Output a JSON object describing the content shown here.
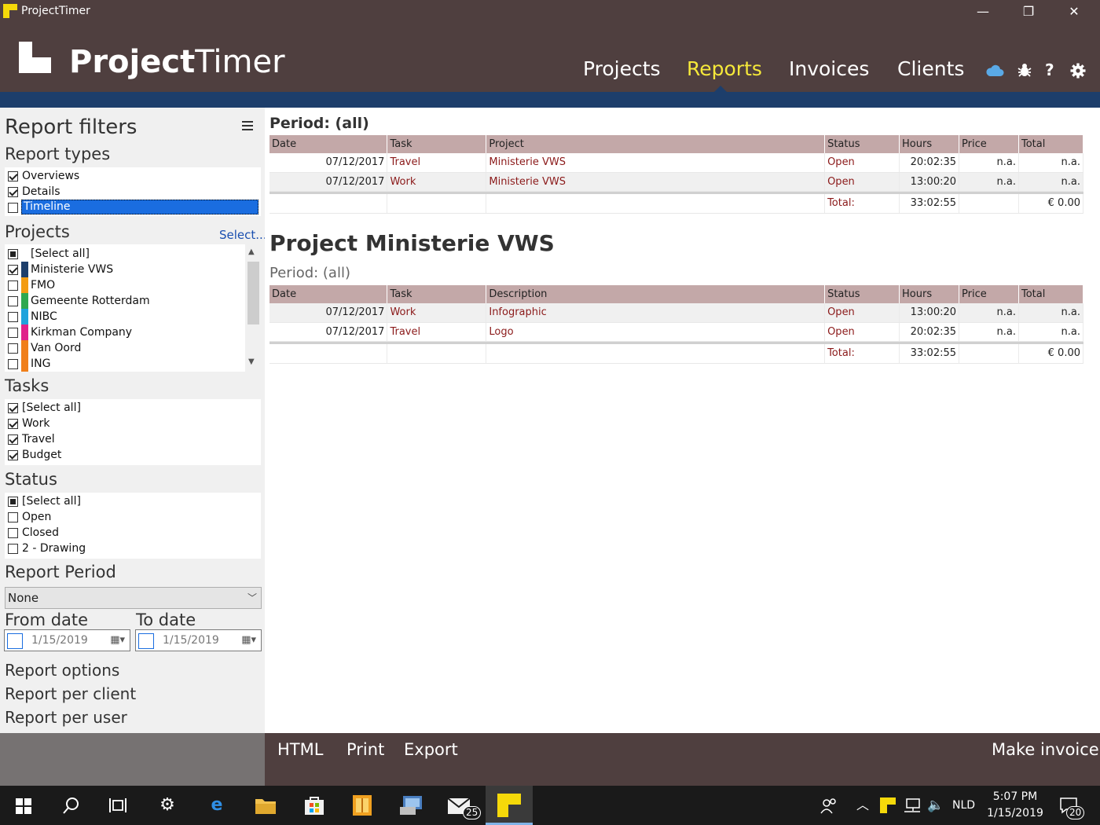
{
  "window": {
    "title": "ProjectTimer",
    "minimize": "—",
    "restore": "❐",
    "close": "✕"
  },
  "header": {
    "logo_bold": "Project",
    "logo_light": "Timer",
    "nav": [
      "Projects",
      "Reports",
      "Invoices",
      "Clients"
    ],
    "active_nav": "Reports",
    "icons": [
      "cloud-icon",
      "bug-icon",
      "help-icon",
      "gear-icon"
    ]
  },
  "filters": {
    "title": "Report filters",
    "report_types": {
      "title": "Report types",
      "items": [
        {
          "label": "Overviews",
          "checked": true
        },
        {
          "label": "Details",
          "checked": true
        },
        {
          "label": "Timeline",
          "checked": false,
          "selected": true
        }
      ]
    },
    "projects": {
      "title": "Projects",
      "select_link": "Select...",
      "items": [
        {
          "label": "[Select all]",
          "state": "partial",
          "color": ""
        },
        {
          "label": "Ministerie VWS",
          "state": "checked",
          "color": "#1d3e6b"
        },
        {
          "label": "FMO",
          "state": "unchecked",
          "color": "#f39c12"
        },
        {
          "label": "Gemeente Rotterdam",
          "state": "unchecked",
          "color": "#2fa84f"
        },
        {
          "label": "NIBC",
          "state": "unchecked",
          "color": "#1fa3dc"
        },
        {
          "label": "Kirkman Company",
          "state": "unchecked",
          "color": "#e0218a"
        },
        {
          "label": "Van Oord",
          "state": "unchecked",
          "color": "#f07f1a"
        },
        {
          "label": "ING",
          "state": "unchecked",
          "color": "#f07f1a"
        }
      ]
    },
    "tasks": {
      "title": "Tasks",
      "items": [
        {
          "label": "[Select all]",
          "state": "checked"
        },
        {
          "label": "Work",
          "state": "checked"
        },
        {
          "label": "Travel",
          "state": "checked"
        },
        {
          "label": "Budget",
          "state": "checked"
        }
      ]
    },
    "status": {
      "title": "Status",
      "items": [
        {
          "label": "[Select all]",
          "state": "partial"
        },
        {
          "label": "Open",
          "state": "unchecked"
        },
        {
          "label": "Closed",
          "state": "unchecked"
        },
        {
          "label": "2 - Drawing",
          "state": "unchecked"
        }
      ]
    },
    "period": {
      "title": "Report Period",
      "value": "None",
      "from_label": "From date",
      "to_label": "To date",
      "from_value": "1/15/2019",
      "to_value": "1/15/2019"
    },
    "options": [
      "Report options",
      "Report per client",
      "Report per user"
    ]
  },
  "report": {
    "overview": {
      "period_title": "Period: (all)",
      "columns": [
        "Date",
        "Task",
        "Project",
        "Status",
        "Hours",
        "Price",
        "Total"
      ],
      "rows": [
        [
          "07/12/2017",
          "Travel",
          "Ministerie VWS",
          "Open",
          "20:02:35",
          "n.a.",
          "n.a."
        ],
        [
          "07/12/2017",
          "Work",
          "Ministerie VWS",
          "Open",
          "13:00:20",
          "n.a.",
          "n.a."
        ]
      ],
      "total_label": "Total:",
      "total_hours": "33:02:55",
      "total_amount": "€ 0.00"
    },
    "project": {
      "title": "Project Ministerie VWS",
      "period": "Period: (all)",
      "columns": [
        "Date",
        "Task",
        "Description",
        "Status",
        "Hours",
        "Price",
        "Total"
      ],
      "rows": [
        [
          "07/12/2017",
          "Work",
          "Infographic",
          "Open",
          "13:00:20",
          "n.a.",
          "n.a."
        ],
        [
          "07/12/2017",
          "Travel",
          "Logo",
          "Open",
          "20:02:35",
          "n.a.",
          "n.a."
        ]
      ],
      "total_label": "Total:",
      "total_hours": "33:02:55",
      "total_amount": "€ 0.00"
    }
  },
  "actions": {
    "html": "HTML",
    "print": "Print",
    "export": "Export",
    "invoice": "Make invoice"
  },
  "taskbar": {
    "mail_badge": "25",
    "language": "NLD",
    "time": "5:07 PM",
    "date": "1/15/2019",
    "notif_badge": "20"
  }
}
